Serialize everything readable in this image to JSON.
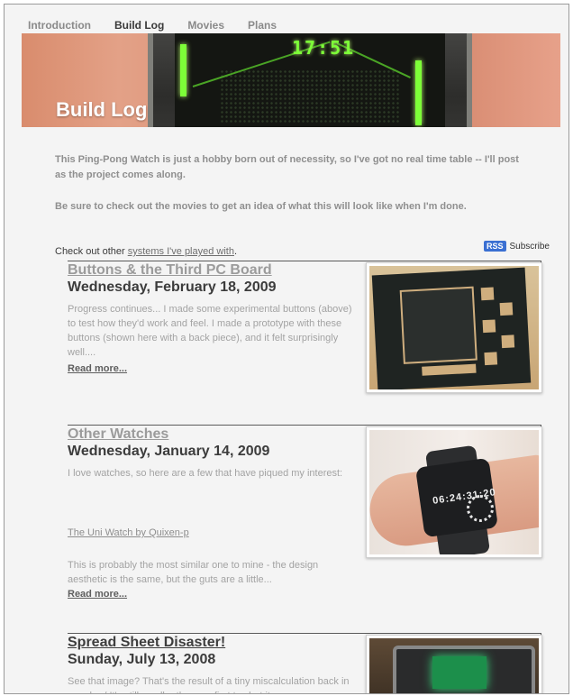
{
  "nav": {
    "items": [
      "Introduction",
      "Build Log",
      "Movies",
      "Plans"
    ],
    "active": "Build Log"
  },
  "banner": {
    "title": "Build Log",
    "display_digits": "17:51"
  },
  "intro": {
    "p1": "This Ping-Pong Watch is just a hobby born out of necessity, so I've got no real time table -- I'll post as the project comes along.",
    "p2": "Be sure to check out the movies to get an idea of what this will look like when I'm done."
  },
  "checkout": {
    "prefix": "Check out other ",
    "link": "systems I've played with",
    "suffix": "."
  },
  "rss": {
    "badge": "RSS",
    "label": "Subscribe"
  },
  "posts": [
    {
      "title": "Buttons & the Third PC Board",
      "date": "Wednesday, February 18, 2009",
      "excerpt": "Progress continues... I made some experimental buttons (above) to test how they'd work and feel. I made a prototype with these buttons (shown here with a back piece), and it felt surprisingly well....",
      "more": "Read more..."
    },
    {
      "title": "Other Watches",
      "date": "Wednesday, January 14, 2009",
      "excerpt": "I love watches, so here are a few that have piqued my interest:",
      "sublink": "The Uni Watch by Quixen-p",
      "excerpt2": "This is probably the most similar one to mine - the design aesthetic is the same, but the guts are a little...",
      "more": "Read more...",
      "image_text": "06:24:31:20"
    },
    {
      "title": "Spread Sheet Disaster!",
      "date": "Sunday, July 13, 2008",
      "excerpt": "See that image? That's the result of a tiny miscalculation back in march :-/ It's still smaller than my first try, but it was"
    }
  ],
  "colors": {
    "page_bg": "#f4f4f4",
    "display_green": "#7dff38",
    "rss_blue": "#3a6fd2"
  }
}
